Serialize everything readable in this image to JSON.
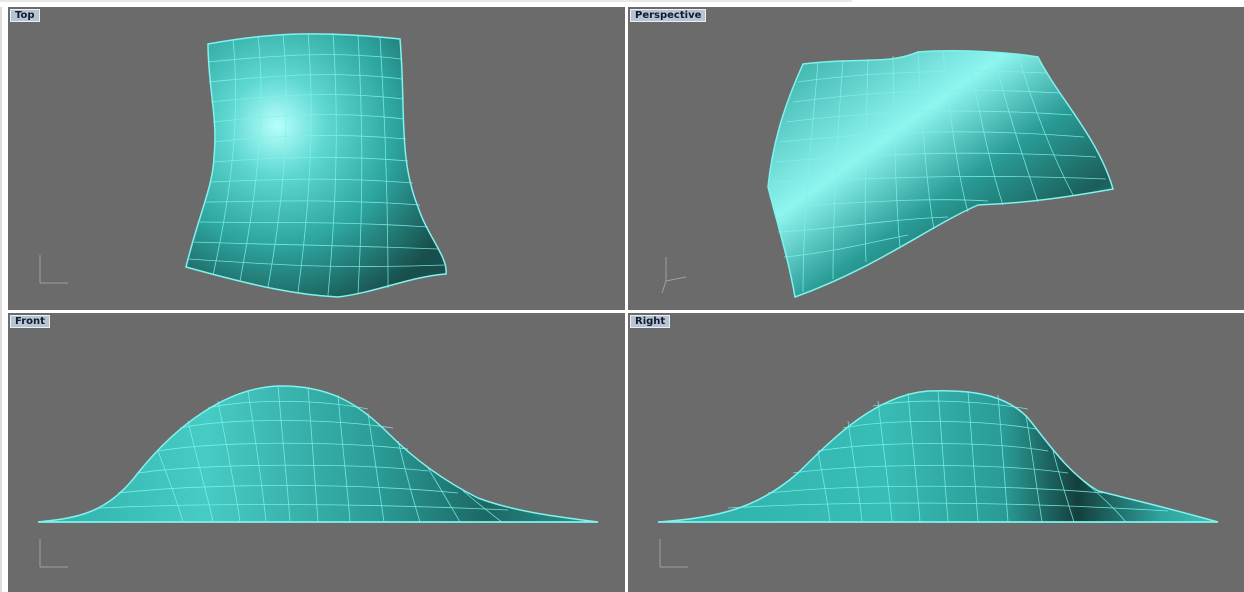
{
  "viewports": {
    "top": {
      "title": "Top"
    },
    "perspective": {
      "title": "Perspective"
    },
    "front": {
      "title": "Front"
    },
    "right": {
      "title": "Right"
    }
  },
  "colors": {
    "viewport_bg": "#6b6b6b",
    "surface": "#3cc8c0",
    "wire": "#7ff3ee",
    "title_bg": "#b9c4d2",
    "title_text": "#0d1b33"
  }
}
